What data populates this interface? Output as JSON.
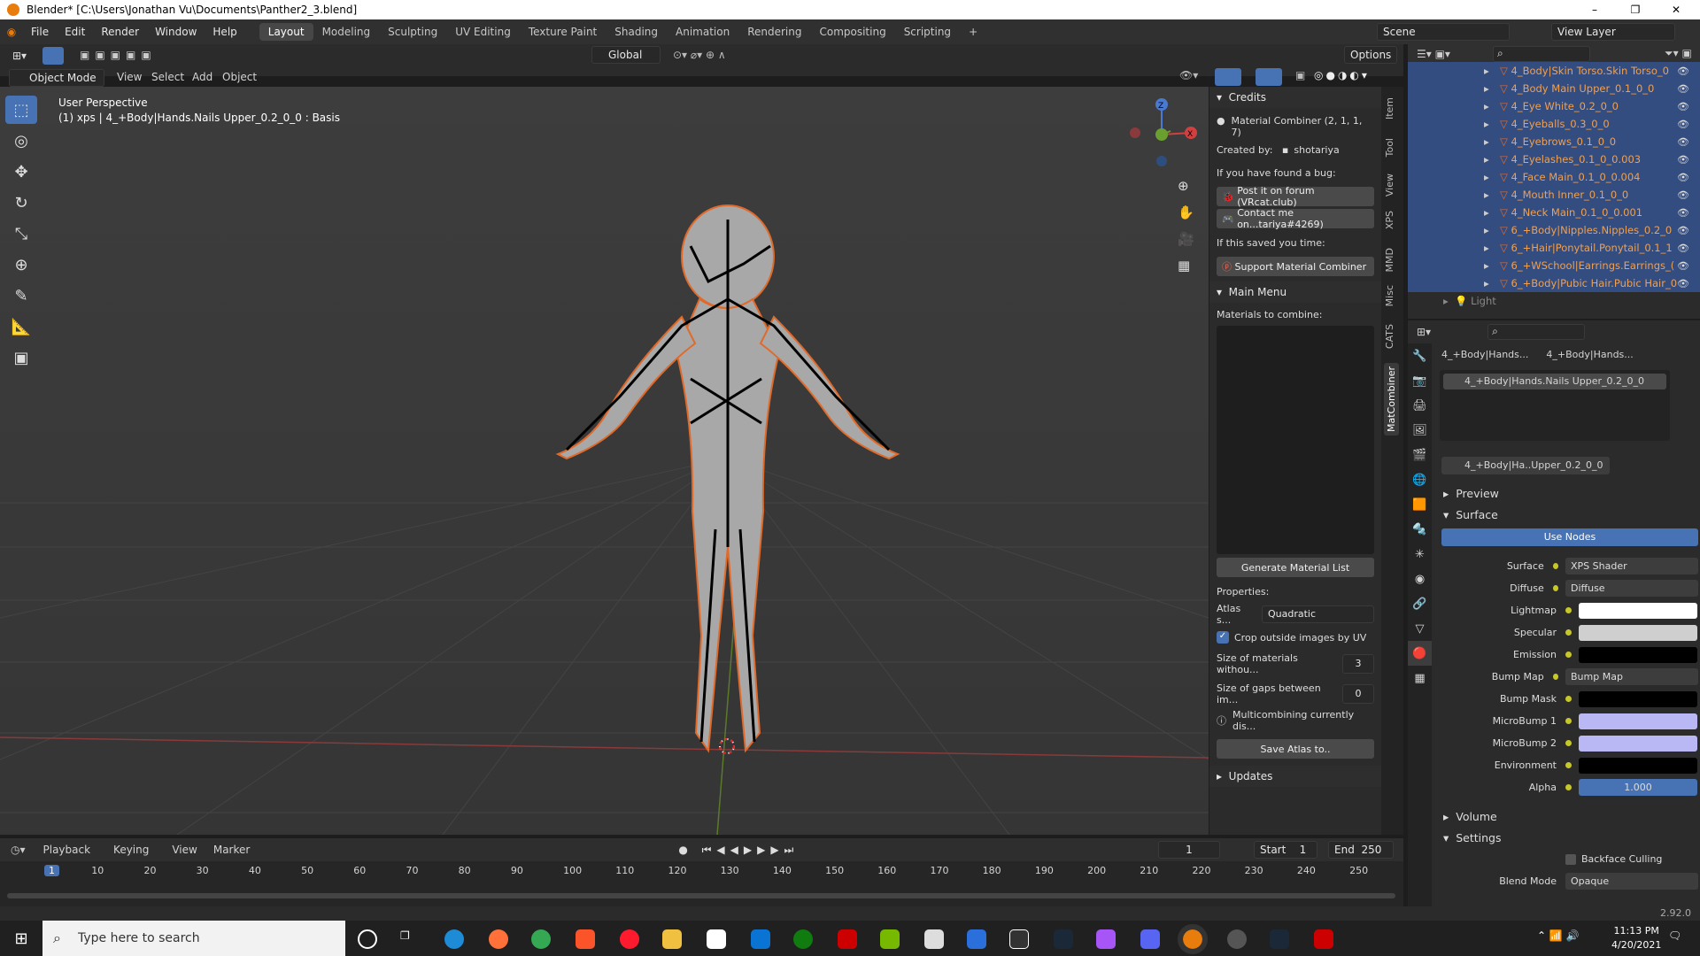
{
  "titlebar": {
    "title": "Blender* [C:\\Users\\Jonathan Vu\\Documents\\Panther2_3.blend]"
  },
  "menu": [
    "File",
    "Edit",
    "Render",
    "Window",
    "Help"
  ],
  "workspaces": [
    "Layout",
    "Modeling",
    "Sculpting",
    "UV Editing",
    "Texture Paint",
    "Shading",
    "Animation",
    "Rendering",
    "Compositing",
    "Scripting"
  ],
  "scene": "Scene",
  "view_layer": "View Layer",
  "viewport": {
    "orientation": "Global",
    "options": "Options",
    "mode": "Object Mode",
    "menus": [
      "View",
      "Select",
      "Add",
      "Object"
    ],
    "info_line1": "User Perspective",
    "info_line2": "(1) xps | 4_+Body|Hands.Nails Upper_0.2_0_0 : Basis"
  },
  "npanel": {
    "tabs": [
      "Item",
      "Tool",
      "View",
      "XPS",
      "MMD",
      "Misc",
      "CATS",
      "MatCombiner"
    ],
    "credits_title": "Credits",
    "combiner_version": "Material Combiner (2, 1, 1, 7)",
    "created_by_label": "Created by:",
    "author": "shotariya",
    "bug_label": "If you have found a bug:",
    "forum_btn": "Post it on forum (VRcat.club)",
    "contact_btn": "Contact me on...tariya#4269)",
    "saved_label": "If this saved you time:",
    "support_btn": "Support Material Combiner",
    "main_menu": "Main Menu",
    "materials_label": "Materials to combine:",
    "generate_btn": "Generate Material List",
    "properties_label": "Properties:",
    "atlas_label": "Atlas s...",
    "atlas_value": "Quadratic",
    "crop_label": "Crop outside images by UV",
    "size_label": "Size of materials withou...",
    "size_value": "3",
    "gaps_label": "Size of gaps between im...",
    "gaps_value": "0",
    "multi_label": "Multicombining currently dis...",
    "save_btn": "Save Atlas to..",
    "updates": "Updates"
  },
  "outliner": {
    "items": [
      "4_Body|Skin Torso.Skin Torso_0",
      "4_Body Main Upper_0.1_0_0",
      "4_Eye White_0.2_0_0",
      "4_Eyeballs_0.3_0_0",
      "4_Eyebrows_0.1_0_0",
      "4_Eyelashes_0.1_0_0.003",
      "4_Face Main_0.1_0_0.004",
      "4_Mouth Inner_0.1_0_0",
      "4_Neck Main_0.1_0_0.001",
      "6_+Body|Nipples.Nipples_0.2_0",
      "6_+Hair|Ponytail.Ponytail_0.1_1",
      "6_+WSchool|Earrings.Earrings_(",
      "6_+Body|Pubic Hair.Pubic Hair_0"
    ],
    "light": "Light"
  },
  "properties": {
    "obj_name": "4_+Body|Hands...",
    "mat_name": "4_+Body|Hands...",
    "slot": "4_+Body|Hands.Nails Upper_0.2_0_0",
    "material_field": "4_+Body|Ha..Upper_0.2_0_0",
    "preview": "Preview",
    "surface": "Surface",
    "use_nodes": "Use Nodes",
    "rows": [
      {
        "label": "Surface",
        "kind": "text",
        "value": "XPS Shader"
      },
      {
        "label": "Diffuse",
        "kind": "text",
        "value": "Diffuse",
        "expand": true
      },
      {
        "label": "Lightmap",
        "kind": "color",
        "value": "#ffffff"
      },
      {
        "label": "Specular",
        "kind": "color",
        "value": "#cfcfcf"
      },
      {
        "label": "Emission",
        "kind": "color",
        "value": "#000000"
      },
      {
        "label": "Bump Map",
        "kind": "text",
        "value": "Bump Map",
        "expand": true
      },
      {
        "label": "Bump Mask",
        "kind": "color",
        "value": "#000000"
      },
      {
        "label": "MicroBump 1",
        "kind": "color",
        "value": "#b9b8f5"
      },
      {
        "label": "MicroBump 2",
        "kind": "color",
        "value": "#b9b8f5"
      },
      {
        "label": "Environment",
        "kind": "color",
        "value": "#000000"
      },
      {
        "label": "Alpha",
        "kind": "num",
        "value": "1.000"
      }
    ],
    "volume": "Volume",
    "settings": "Settings",
    "backface": "Backface Culling",
    "blend_label": "Blend Mode",
    "blend_value": "Opaque"
  },
  "timeline": {
    "menus": [
      "Playback",
      "Keying",
      "View",
      "Marker"
    ],
    "current": "1",
    "start_label": "Start",
    "start": "1",
    "end_label": "End",
    "end": "250",
    "ticks": [
      "1",
      "10",
      "20",
      "30",
      "40",
      "50",
      "60",
      "70",
      "80",
      "90",
      "100",
      "110",
      "120",
      "130",
      "140",
      "150",
      "160",
      "170",
      "180",
      "190",
      "200",
      "210",
      "220",
      "230",
      "240",
      "250"
    ]
  },
  "status": {
    "version": "2.92.0"
  },
  "taskbar": {
    "search_placeholder": "Type here to search",
    "time": "11:13 PM",
    "date": "4/20/2021"
  }
}
